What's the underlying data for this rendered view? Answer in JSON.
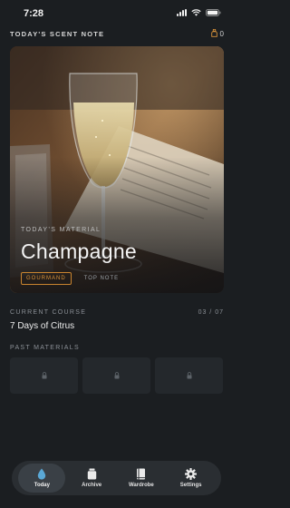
{
  "status": {
    "time": "7:28"
  },
  "header": {
    "title": "TODAY'S SCENT NOTE",
    "credits": "0"
  },
  "hero": {
    "label": "TODAY'S MATERIAL",
    "title": "Champagne",
    "tags": [
      "GOURMAND",
      "TOP NOTE"
    ]
  },
  "course": {
    "label": "CURRENT COURSE",
    "progress": "03 / 07",
    "name": "7 Days of Citrus"
  },
  "past": {
    "label": "PAST MATERIALS"
  },
  "tabs": [
    {
      "label": "Today",
      "icon": "drop-icon",
      "active": true
    },
    {
      "label": "Archive",
      "icon": "jar-icon",
      "active": false
    },
    {
      "label": "Wardrobe",
      "icon": "book-icon",
      "active": false
    },
    {
      "label": "Settings",
      "icon": "gear-icon",
      "active": false
    }
  ],
  "colors": {
    "accent": "#d9933a",
    "background": "#1b1e21",
    "active_tab": "#5aa8d6"
  }
}
